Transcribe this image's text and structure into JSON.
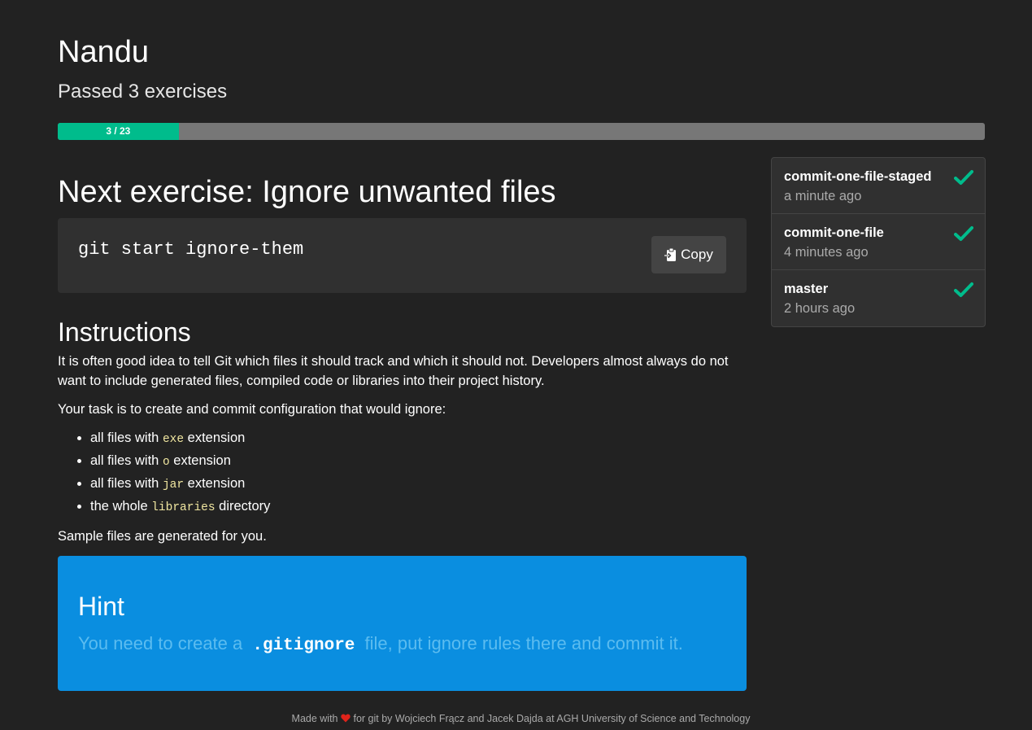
{
  "user": {
    "name": "Nandu",
    "passed_text": "Passed 3 exercises"
  },
  "progress": {
    "label": "3 / 23",
    "completed": 3,
    "total": 23,
    "color": "#00bc8c"
  },
  "next_exercise": {
    "title": "Next exercise: Ignore unwanted files",
    "command": "git start ignore-them",
    "copy_label": "Copy",
    "copy_icon": "clipboard-icon"
  },
  "instructions": {
    "title": "Instructions",
    "intro": "It is often good idea to tell Git which files it should track and which it should not. Developers almost always do not want to include generated files, compiled code or libraries into their project history.",
    "task": "Your task is to create and commit configuration that would ignore:",
    "items": [
      {
        "before": "all files with",
        "code": "exe",
        "after": "extension"
      },
      {
        "before": "all files with",
        "code": "o",
        "after": "extension"
      },
      {
        "before": "all files with",
        "code": "jar",
        "after": "extension"
      },
      {
        "before": "the whole",
        "code": "libraries",
        "after": "directory"
      }
    ],
    "sample": "Sample files are generated for you."
  },
  "hint": {
    "title": "Hint",
    "before": "You need to create a",
    "code": ".gitignore",
    "after": "file, put ignore rules there and commit it.",
    "background": "#0a8ee0"
  },
  "history": [
    {
      "name": "commit-one-file-staged",
      "time": "a minute ago",
      "status": "passed",
      "icon": "check-icon"
    },
    {
      "name": "commit-one-file",
      "time": "4 minutes ago",
      "status": "passed",
      "icon": "check-icon"
    },
    {
      "name": "master",
      "time": "2 hours ago",
      "status": "passed",
      "icon": "check-icon"
    }
  ],
  "footer": {
    "made_with": "Made with",
    "rest": "for git by Wojciech Frącz and Jacek Dajda at AGH University of Science and Technology",
    "heart_color": "#e0231a"
  }
}
